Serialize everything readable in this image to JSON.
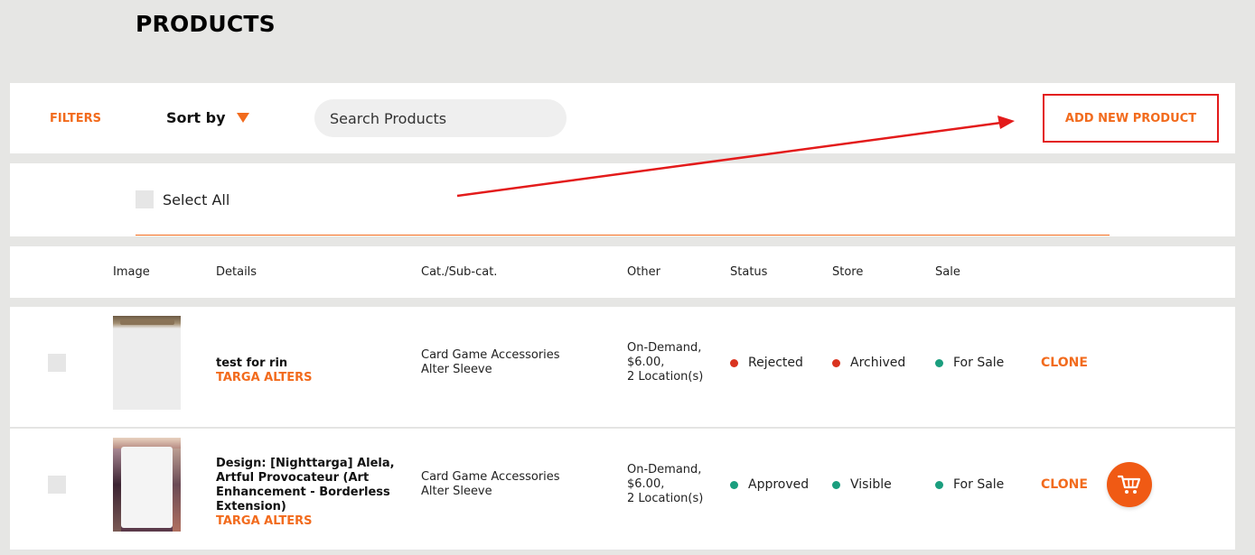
{
  "page": {
    "title": "PRODUCTS"
  },
  "toolbar": {
    "filters_label": "FILTERS",
    "sort_label": "Sort by",
    "search_placeholder": "Search Products",
    "add_product_label": "ADD NEW PRODUCT"
  },
  "selection": {
    "select_all_label": "Select All"
  },
  "table": {
    "headers": [
      "Image",
      "Details",
      "Cat./Sub-cat.",
      "Other",
      "Status",
      "Store",
      "Sale"
    ],
    "rows": [
      {
        "name": "test for rin",
        "store_name": "TARGA ALTERS",
        "category": "Card Game Accessories",
        "subcategory": "Alter Sleeve",
        "other_line1": "On-Demand,",
        "other_line2": "$6.00,",
        "other_line3": "2 Location(s)",
        "status": "Rejected",
        "status_color": "#d9331f",
        "store": "Archived",
        "store_color": "#d9331f",
        "sale": "For Sale",
        "sale_color": "#1a9e7e",
        "action": "CLONE"
      },
      {
        "name": "Design: [Nighttarga] Alela, Artful Provocateur (Art Enhancement - Borderless Extension)",
        "store_name": "TARGA ALTERS",
        "category": "Card Game Accessories",
        "subcategory": "Alter Sleeve",
        "other_line1": "On-Demand,",
        "other_line2": "$6.00,",
        "other_line3": "2 Location(s)",
        "status": "Approved",
        "status_color": "#1a9e7e",
        "store": "Visible",
        "store_color": "#1a9e7e",
        "sale": "For Sale",
        "sale_color": "#1a9e7e",
        "action": "CLONE"
      }
    ]
  },
  "colors": {
    "accent": "#f26b1d",
    "annotation_red": "#e31b1b",
    "background": "#e6e6e4"
  },
  "icons": {
    "sort": "triangle-down-icon",
    "cart": "shopping-cart-icon"
  }
}
